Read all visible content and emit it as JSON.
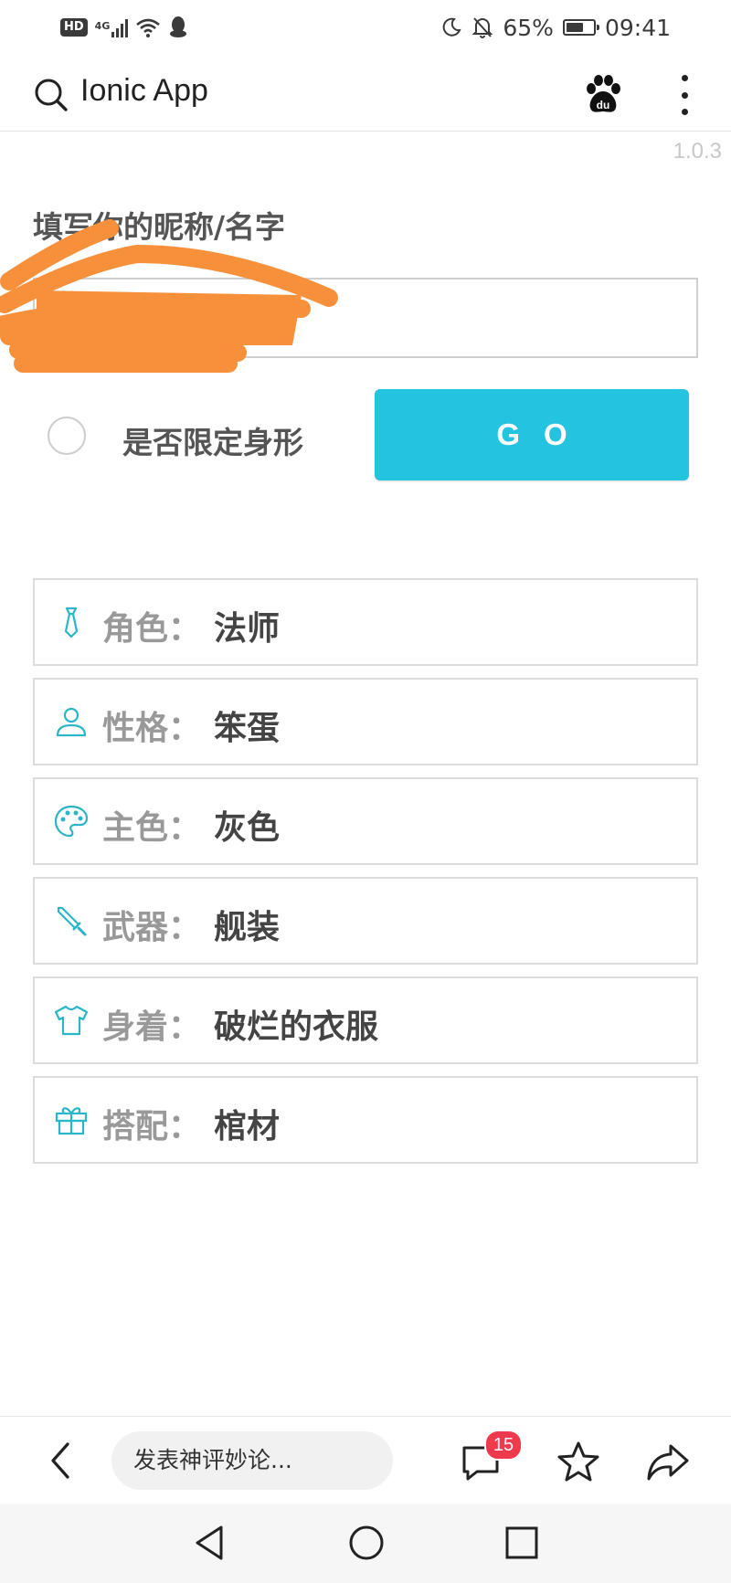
{
  "status_bar": {
    "hd": "HD",
    "network": "4G",
    "battery_percent": "65%",
    "battery_level": 0.65,
    "time": "09:41"
  },
  "header": {
    "title": "Ionic App",
    "icons": [
      "search-icon",
      "baidu-paw-icon",
      "more-vert-icon"
    ]
  },
  "version": "1.0.3",
  "form": {
    "nickname_label": "填写你的昵称/名字",
    "nickname_value": "",
    "checkbox_label": "是否限定身形",
    "checkbox_checked": false,
    "go_label": "GO"
  },
  "attributes": [
    {
      "icon": "tie-icon",
      "key": "角色：",
      "value": "法师"
    },
    {
      "icon": "person-icon",
      "key": "性格：",
      "value": "笨蛋"
    },
    {
      "icon": "palette-icon",
      "key": "主色：",
      "value": "灰色"
    },
    {
      "icon": "sword-icon",
      "key": "武器：",
      "value": "舰装"
    },
    {
      "icon": "shirt-icon",
      "key": "身着：",
      "value": "破烂的衣服"
    },
    {
      "icon": "gift-icon",
      "key": "搭配：",
      "value": "棺材"
    }
  ],
  "bottom_bar": {
    "comment_placeholder": "发表神评妙论...",
    "comment_count": "15"
  },
  "colors": {
    "accent": "#24c3df",
    "icon_teal": "#2bb5c8",
    "badge_red": "#ee3a4c",
    "scribble": "#f7903b"
  }
}
